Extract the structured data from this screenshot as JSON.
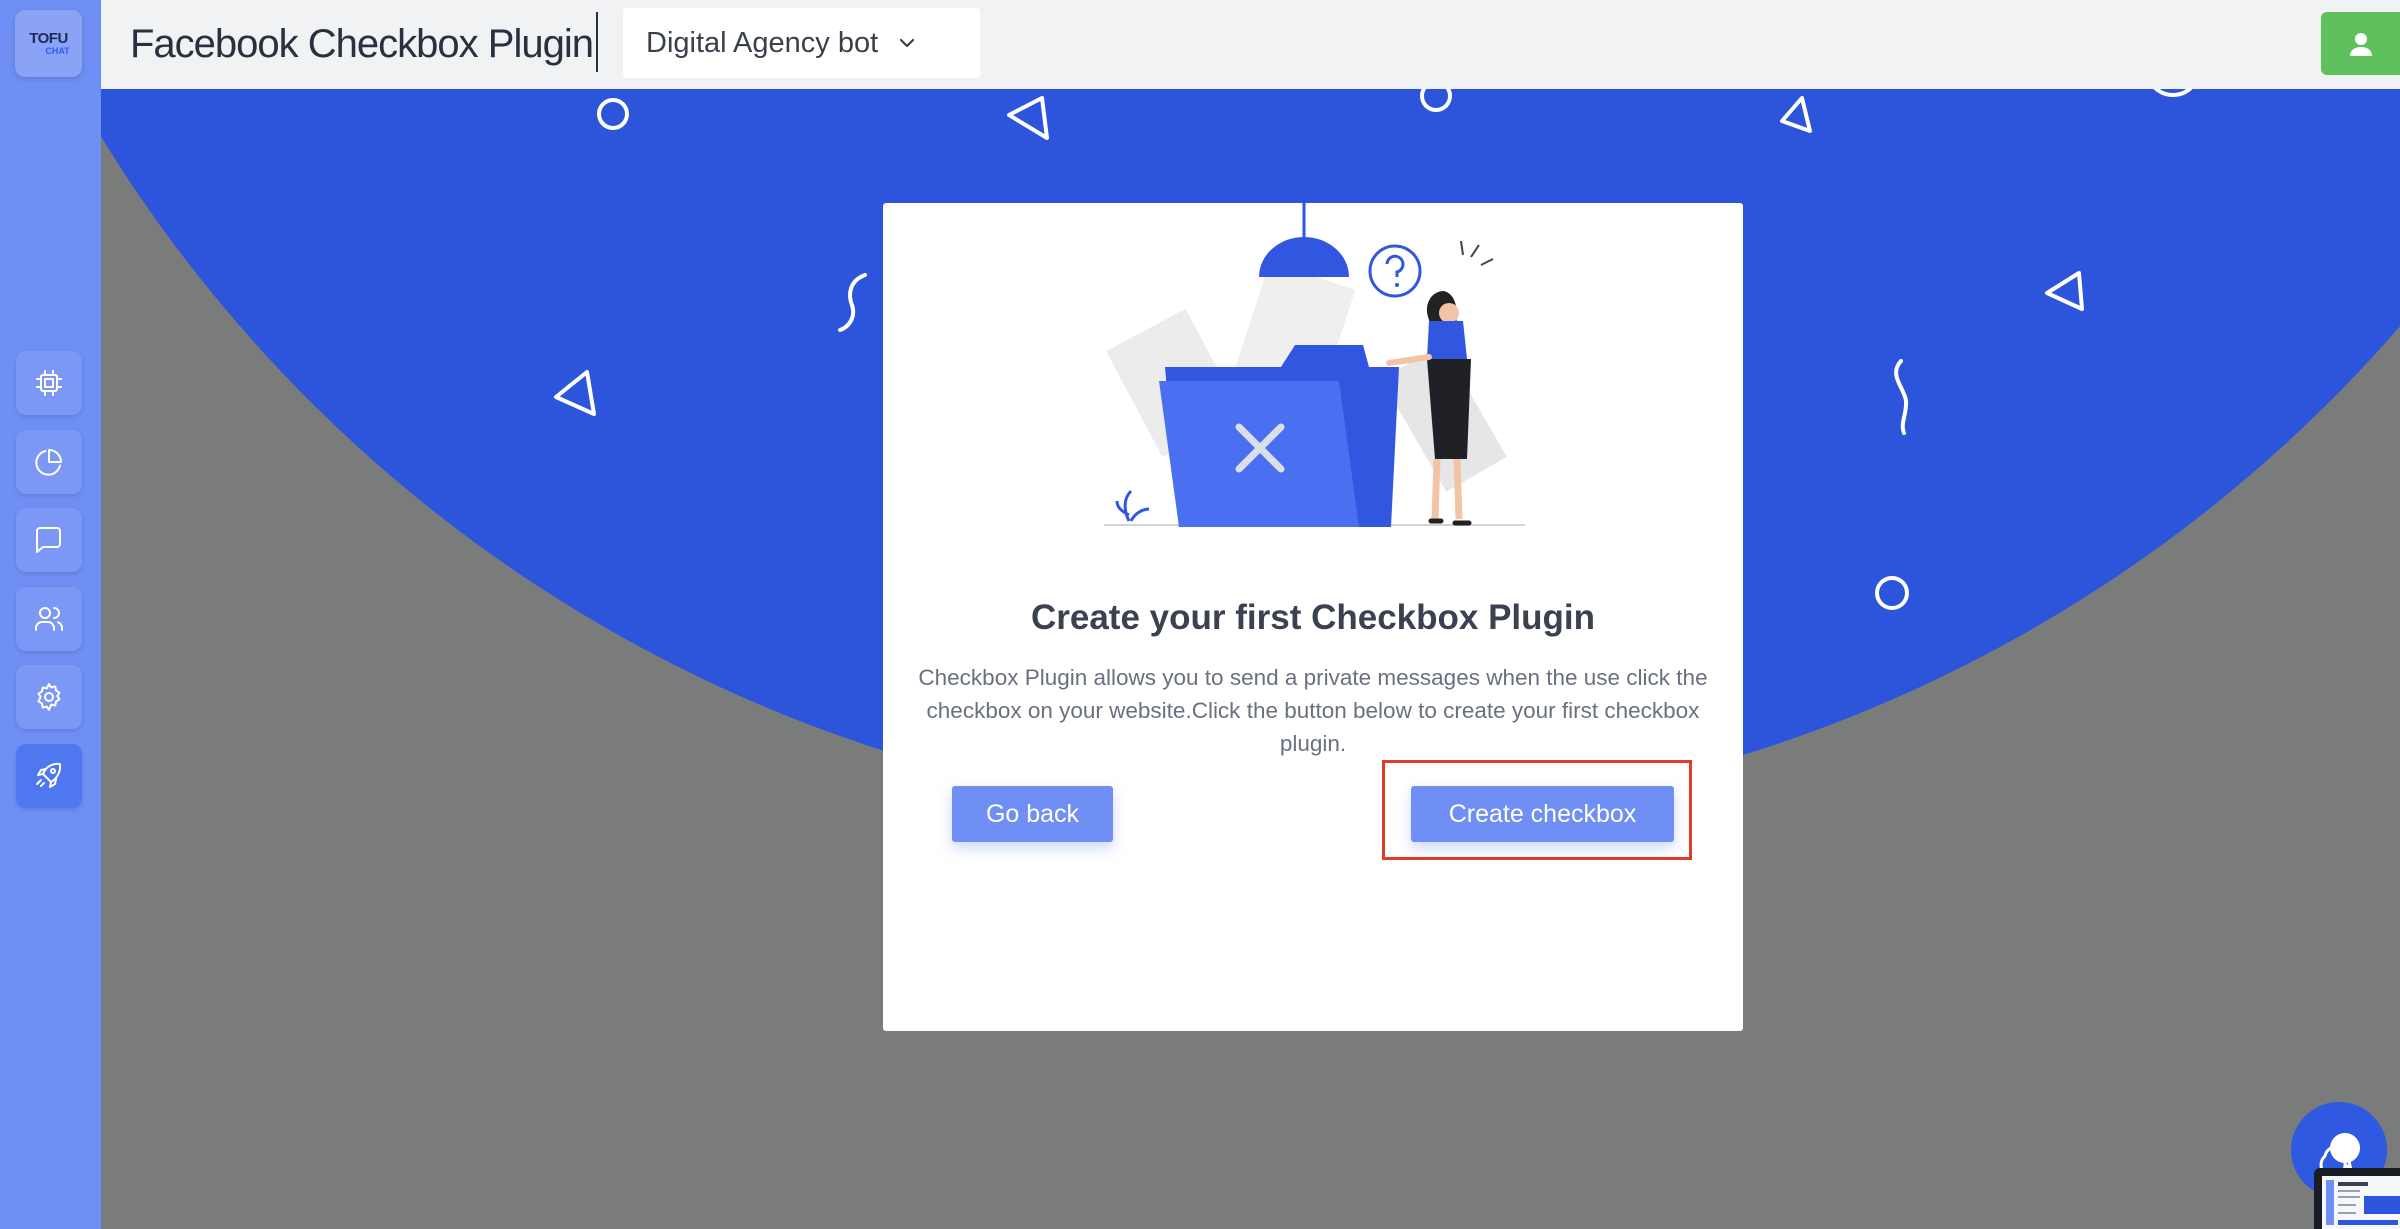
{
  "brand": {
    "logo_line1": "TOFU",
    "logo_line2": "CHAT"
  },
  "header": {
    "title": "Facebook Checkbox Plugin",
    "bot_selector": {
      "selected": "Digital Agency bot"
    }
  },
  "sidebar": {
    "items": [
      {
        "name": "chip-icon"
      },
      {
        "name": "pie-chart-icon"
      },
      {
        "name": "message-icon"
      },
      {
        "name": "users-icon"
      },
      {
        "name": "gear-icon"
      },
      {
        "name": "rocket-icon",
        "active": true
      }
    ]
  },
  "empty_state": {
    "title": "Create your first Checkbox Plugin",
    "description": "Checkbox Plugin allows you to send a private messages when the use click the checkbox on your website.Click the button below to create your first checkbox plugin.",
    "back_label": "Go back",
    "create_label": "Create checkbox"
  },
  "colors": {
    "accent": "#6f8ff5",
    "circle_blue": "#2c55dc",
    "user_button": "#5fc15d",
    "highlight": "#e23b2a"
  }
}
